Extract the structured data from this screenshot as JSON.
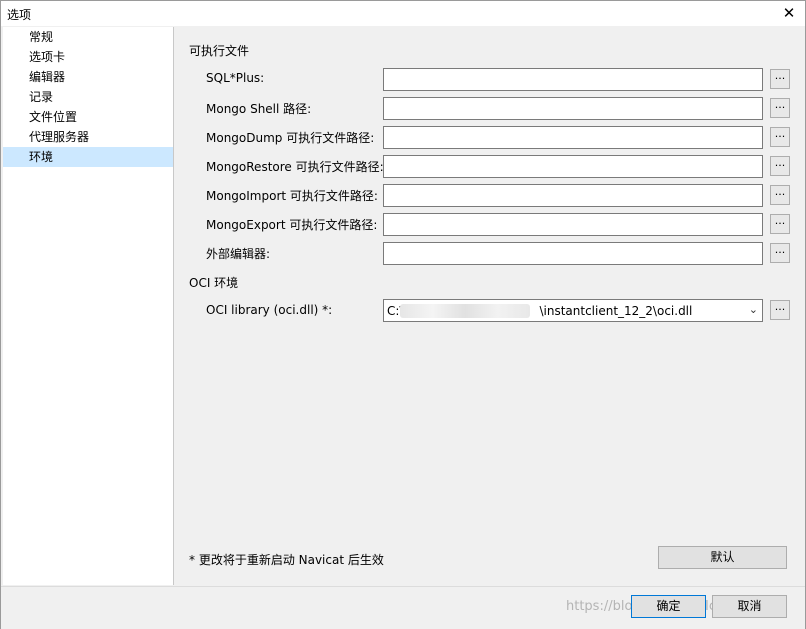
{
  "window": {
    "title": "选项",
    "close_glyph": "✕"
  },
  "sidebar": {
    "items": [
      {
        "label": "常规"
      },
      {
        "label": "选项卡"
      },
      {
        "label": "编辑器"
      },
      {
        "label": "记录"
      },
      {
        "label": "文件位置"
      },
      {
        "label": "代理服务器"
      },
      {
        "label": "环境",
        "selected": true
      }
    ]
  },
  "executables": {
    "section_title": "可执行文件",
    "rows": [
      {
        "label": "SQL*Plus:",
        "value": ""
      },
      {
        "label": "Mongo Shell 路径:",
        "value": ""
      },
      {
        "label": "MongoDump 可执行文件路径:",
        "value": ""
      },
      {
        "label": "MongoRestore 可执行文件路径:",
        "value": ""
      },
      {
        "label": "MongoImport 可执行文件路径:",
        "value": ""
      },
      {
        "label": "MongoExport 可执行文件路径:",
        "value": ""
      },
      {
        "label": "外部编辑器:",
        "value": ""
      }
    ],
    "browse_label": "..."
  },
  "oci": {
    "section_title": "OCI 环境",
    "library_label": "OCI library (oci.dll) *:",
    "library_prefix": "C:\\",
    "library_suffix": "\\instantclient_12_2\\oci.dll",
    "browse_label": "..."
  },
  "footer": {
    "note": "* 更改将于重新启动 Navicat 后生效",
    "default_button": "默认"
  },
  "buttons": {
    "ok": "确定",
    "cancel": "取消"
  },
  "watermark": "https://blog.csdn.net/Ic_noydvar",
  "colors": {
    "selection": "#cce8ff",
    "focus_border": "#0078d7"
  }
}
